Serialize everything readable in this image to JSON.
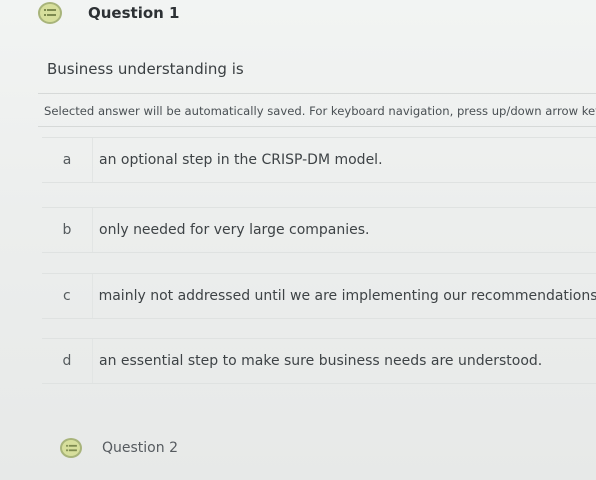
{
  "question": {
    "title": "Question 1",
    "icon": "question-list-icon",
    "prompt": "Business understanding is",
    "instructions": "Selected answer will be automatically saved. For keyboard navigation, press up/down arrow keys to select an answer."
  },
  "options": [
    {
      "letter": "a",
      "text": "an optional step in the CRISP-DM model."
    },
    {
      "letter": "b",
      "text": "only needed for very large companies."
    },
    {
      "letter": "c",
      "text": "mainly not addressed until we are implementing our recommendations."
    },
    {
      "letter": "d",
      "text": "an essential step to make sure business needs are understood."
    }
  ],
  "next_question": {
    "title": "Question 2",
    "icon": "question-list-icon"
  },
  "colors": {
    "icon_fill": "#d7df9c",
    "icon_border": "#a8b47a",
    "text": "#3e4346"
  }
}
